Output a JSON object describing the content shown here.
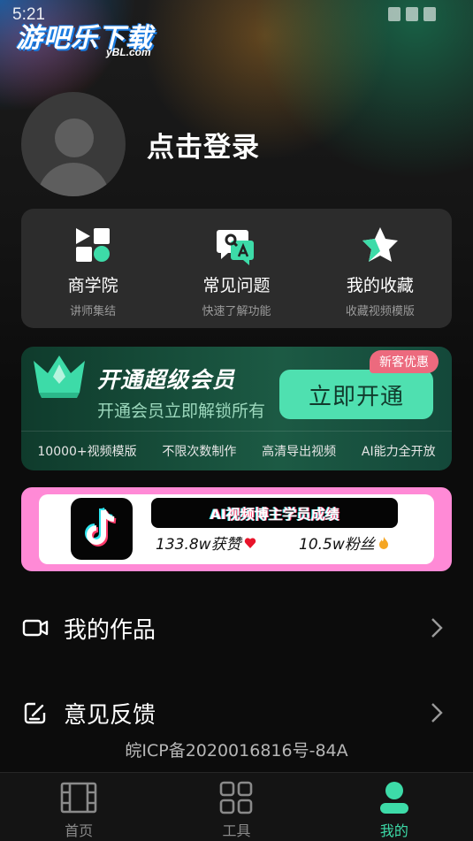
{
  "status_bar": {
    "time": "5:21"
  },
  "watermark": {
    "main": "游吧乐下载",
    "sub": "yBL.com"
  },
  "profile": {
    "login_label": "点击登录"
  },
  "quick_links": [
    {
      "title": "商学院",
      "subtitle": "讲师集结",
      "icon": "business-school-icon"
    },
    {
      "title": "常见问题",
      "subtitle": "快速了解功能",
      "icon": "faq-icon"
    },
    {
      "title": "我的收藏",
      "subtitle": "收藏视频模版",
      "icon": "star-favorites-icon"
    }
  ],
  "vip": {
    "title": "开通超级会员",
    "subtitle": "开通会员立即解锁所有",
    "button_label": "立即开通",
    "badge": "新客优惠",
    "features": [
      "10000+视频模版",
      "不限次数制作",
      "高清导出视频",
      "AI能力全开放"
    ]
  },
  "banner": {
    "title": "AI视频博主学员成绩",
    "likes": "133.8w获赞",
    "fans": "10.5w粉丝"
  },
  "menu": {
    "works_label": "我的作品",
    "feedback_label": "意见反馈"
  },
  "icp": "皖ICP备2020016816号-84A",
  "tabs": [
    {
      "label": "首页",
      "icon": "film-icon"
    },
    {
      "label": "工具",
      "icon": "grid-icon"
    },
    {
      "label": "我的",
      "icon": "user-icon"
    }
  ],
  "colors": {
    "accent": "#3ddba8",
    "vip_button": "#4fe0b0",
    "badge": "#ec6a7e",
    "banner_border": "#ff8ad6",
    "card_bg": "#2c2c2c"
  }
}
